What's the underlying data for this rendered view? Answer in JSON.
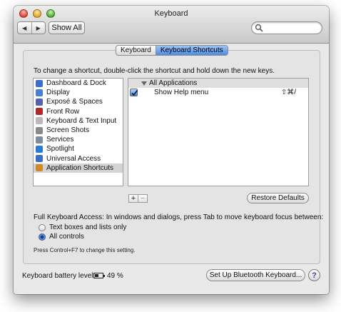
{
  "window": {
    "title": "Keyboard"
  },
  "toolbar": {
    "back_glyph": "◀",
    "forward_glyph": "▶",
    "show_all_label": "Show All",
    "search_placeholder": ""
  },
  "tabs": [
    {
      "label": "Keyboard",
      "active": false
    },
    {
      "label": "Keyboard Shortcuts",
      "active": true
    }
  ],
  "instruction": "To change a shortcut, double-click the shortcut and hold down the new keys.",
  "categories": [
    {
      "label": "Dashboard & Dock",
      "icon": "dashboard-icon",
      "color": "#3a6fc4"
    },
    {
      "label": "Display",
      "icon": "display-icon",
      "color": "#4a7fd0"
    },
    {
      "label": "Exposé & Spaces",
      "icon": "expose-icon",
      "color": "#5561a8"
    },
    {
      "label": "Front Row",
      "icon": "front-row-icon",
      "color": "#b0282a"
    },
    {
      "label": "Keyboard & Text Input",
      "icon": "keyboard-icon",
      "color": "#b9b9b9"
    },
    {
      "label": "Screen Shots",
      "icon": "screenshot-icon",
      "color": "#8a8a8a"
    },
    {
      "label": "Services",
      "icon": "services-icon",
      "color": "#7d8d9d"
    },
    {
      "label": "Spotlight",
      "icon": "spotlight-icon",
      "color": "#2c7bd6"
    },
    {
      "label": "Universal Access",
      "icon": "universal-access-icon",
      "color": "#3a6fc4"
    },
    {
      "label": "Application Shortcuts",
      "icon": "application-shortcuts-icon",
      "color": "#d0892a",
      "selected": true
    }
  ],
  "shortcuts": {
    "group_label": "All Applications",
    "items": [
      {
        "name": "Show Help menu",
        "keys": "⇧⌘/",
        "enabled": true
      }
    ]
  },
  "list_controls": {
    "add_label": "+",
    "remove_label": "−"
  },
  "restore_label": "Restore Defaults",
  "full_keyboard_access": {
    "label": "Full Keyboard Access: In windows and dialogs, press Tab to move keyboard focus between:",
    "options": [
      {
        "label": "Text boxes and lists only",
        "selected": false
      },
      {
        "label": "All controls",
        "selected": true
      }
    ],
    "hint": "Press Control+F7 to change this setting."
  },
  "battery": {
    "label": "Keyboard battery level:",
    "value": "49 %",
    "level": 0.49
  },
  "bluetooth_button_label": "Set Up Bluetooth Keyboard...",
  "help_label": "?",
  "colors": {
    "accent": "#4c8de6",
    "selection": "#d4d4d4"
  }
}
